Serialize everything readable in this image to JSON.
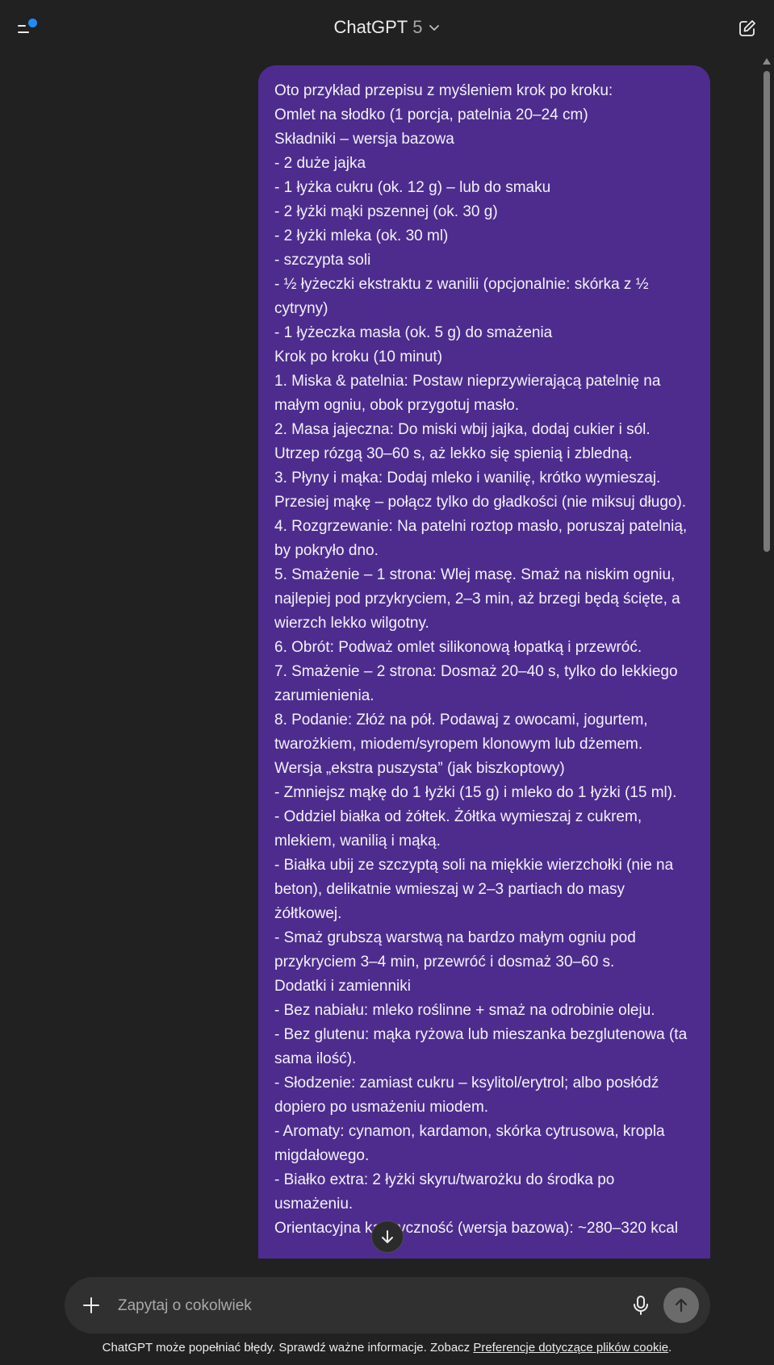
{
  "header": {
    "title": "ChatGPT",
    "version": "5"
  },
  "message": {
    "lines": [
      "Oto przykład przepisu z myśleniem krok po kroku:",
      "Omlet na słodko (1 porcja, patelnia 20–24 cm)",
      "Składniki – wersja bazowa",
      "- 2 duże jajka",
      "- 1 łyżka cukru (ok. 12 g) – lub do smaku",
      "- 2 łyżki mąki pszennej (ok. 30 g)",
      "- 2 łyżki mleka (ok. 30 ml)",
      "- szczypta soli",
      "- ½ łyżeczki ekstraktu z wanilii (opcjonalnie: skórka z ½ cytryny)",
      "- 1 łyżeczka masła (ok. 5 g) do smażenia",
      "Krok po kroku (10 minut)",
      "1. Miska & patelnia: Postaw nieprzywierającą patelnię na małym ogniu, obok przygotuj masło.",
      "2. Masa jajeczna: Do miski wbij jajka, dodaj cukier i sól. Utrzep rózgą 30–60 s, aż lekko się spienią i zbledną.",
      "3. Płyny i mąka: Dodaj mleko i wanilię, krótko wymieszaj. Przesiej mąkę – połącz tylko do gładkości (nie miksuj długo).",
      "4. Rozgrzewanie: Na patelni roztop masło, poruszaj patelnią, by pokryło dno.",
      "5. Smażenie – 1 strona: Wlej masę. Smaż na niskim ogniu, najlepiej pod przykryciem, 2–3 min, aż brzegi będą ścięte, a wierzch lekko wilgotny.",
      "6. Obrót: Podważ omlet silikonową łopatką i przewróć.",
      "7. Smażenie – 2 strona: Dosmaż 20–40 s, tylko do lekkiego zarumienienia.",
      "8. Podanie: Złóż na pół. Podawaj z owocami, jogurtem, twarożkiem, miodem/syropem klonowym lub dżemem.",
      "Wersja „ekstra puszysta” (jak biszkoptowy)",
      "- Zmniejsz mąkę do 1 łyżki (15 g) i mleko do 1 łyżki (15 ml).",
      "- Oddziel białka od żółtek. Żółtka wymieszaj z cukrem, mlekiem, wanilią i mąką.",
      "- Białka ubij ze szczyptą soli na miękkie wierzchołki (nie na beton), delikatnie wmieszaj w 2–3 partiach do masy żółtkowej.",
      "- Smaż grubszą warstwą na bardzo małym ogniu pod przykryciem 3–4 min, przewróć i dosmaż 30–60 s.",
      "Dodatki i zamienniki",
      "- Bez nabiału: mleko roślinne + smaż na odrobinie oleju.",
      "- Bez glutenu: mąka ryżowa lub mieszanka bezglutenowa (ta sama ilość).",
      "- Słodzenie: zamiast cukru – ksylitol/erytrol; albo posłódź dopiero po usmażeniu miodem.",
      "- Aromaty: cynamon, kardamon, skórka cytrusowa, kropla migdałowego.",
      "- Białko extra: 2 łyżki skyru/twarożku do środka po usmażeniu.",
      "Orientacyjna kaloryczność (wersja bazowa): ~280–320 kcal"
    ]
  },
  "composer": {
    "placeholder": "Zapytaj o cokolwiek"
  },
  "footer": {
    "disclaimer": "ChatGPT może popełniać błędy. Sprawdź ważne informacje. Zobacz ",
    "link": "Preferencje dotyczące plików cookie",
    "end": "."
  }
}
